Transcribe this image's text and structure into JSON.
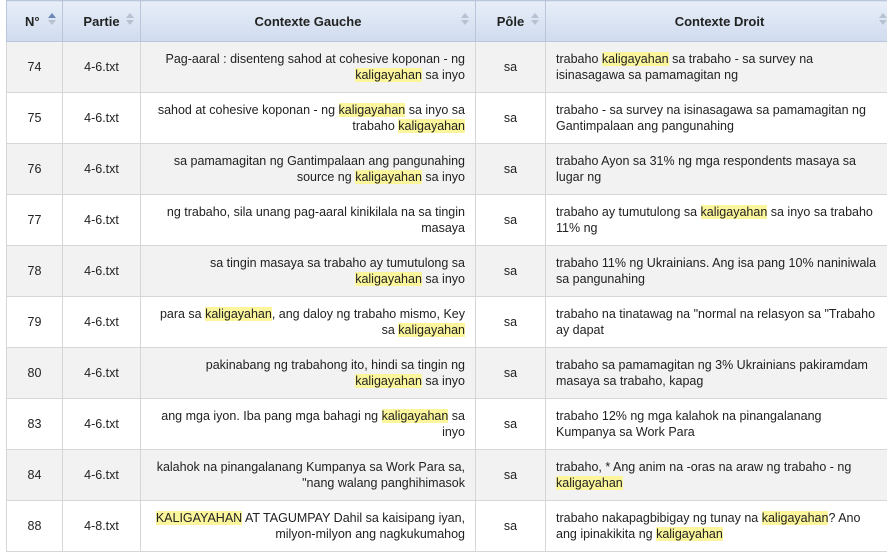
{
  "headers": {
    "no": "N°",
    "partie": "Partie",
    "gauche": "Contexte Gauche",
    "pole": "Pôle",
    "droit": "Contexte Droit"
  },
  "rows": [
    {
      "no": "74",
      "partie": "4-6.txt",
      "left": [
        {
          "t": "Pag-aaral : disenteng sahod at cohesive koponan - ng "
        },
        {
          "t": "kaligayahan",
          "h": true
        },
        {
          "t": " sa inyo"
        }
      ],
      "pole": "sa",
      "right": [
        {
          "t": "trabaho "
        },
        {
          "t": "kaligayahan",
          "h": true
        },
        {
          "t": " sa trabaho - sa survey na isinasagawa sa pamamagitan ng"
        }
      ]
    },
    {
      "no": "75",
      "partie": "4-6.txt",
      "left": [
        {
          "t": "sahod at cohesive koponan - ng "
        },
        {
          "t": "kaligayahan",
          "h": true
        },
        {
          "t": " sa inyo sa trabaho "
        },
        {
          "t": "kaligayahan",
          "h": true
        }
      ],
      "pole": "sa",
      "right": [
        {
          "t": "trabaho - sa survey na isinasagawa sa pamamagitan ng Gantimpalaan ang pangunahing"
        }
      ]
    },
    {
      "no": "76",
      "partie": "4-6.txt",
      "left": [
        {
          "t": "sa pamamagitan ng Gantimpalaan ang pangunahing source ng "
        },
        {
          "t": "kaligayahan",
          "h": true
        },
        {
          "t": " sa inyo"
        }
      ],
      "pole": "sa",
      "right": [
        {
          "t": "trabaho Ayon sa 31% ng mga respondents masaya sa lugar ng"
        }
      ]
    },
    {
      "no": "77",
      "partie": "4-6.txt",
      "left": [
        {
          "t": "ng trabaho, sila unang pag-aaral kinikilala na sa tingin masaya"
        }
      ],
      "pole": "sa",
      "right": [
        {
          "t": "trabaho ay tumutulong sa "
        },
        {
          "t": "kaligayahan",
          "h": true
        },
        {
          "t": " sa inyo sa trabaho 11% ng"
        }
      ]
    },
    {
      "no": "78",
      "partie": "4-6.txt",
      "left": [
        {
          "t": "sa tingin masaya sa trabaho ay tumutulong sa "
        },
        {
          "t": "kaligayahan",
          "h": true
        },
        {
          "t": " sa inyo"
        }
      ],
      "pole": "sa",
      "right": [
        {
          "t": "trabaho 11% ng Ukrainians. Ang isa pang 10% naniniwala sa pangunahing"
        }
      ]
    },
    {
      "no": "79",
      "partie": "4-6.txt",
      "left": [
        {
          "t": "para sa "
        },
        {
          "t": "kaligayahan",
          "h": true
        },
        {
          "t": ", ang daloy ng trabaho mismo, Key sa "
        },
        {
          "t": "kaligayahan",
          "h": true
        }
      ],
      "pole": "sa",
      "right": [
        {
          "t": "trabaho na tinatawag na \"normal na relasyon sa \"Trabaho ay dapat"
        }
      ]
    },
    {
      "no": "80",
      "partie": "4-6.txt",
      "left": [
        {
          "t": "pakinabang ng trabahong ito, hindi sa tingin ng "
        },
        {
          "t": "kaligayahan",
          "h": true
        },
        {
          "t": " sa inyo"
        }
      ],
      "pole": "sa",
      "right": [
        {
          "t": "trabaho sa pamamagitan ng 3% Ukrainians pakiramdam masaya sa trabaho, kapag"
        }
      ]
    },
    {
      "no": "83",
      "partie": "4-6.txt",
      "left": [
        {
          "t": "ang mga iyon. Iba pang mga bahagi ng "
        },
        {
          "t": "kaligayahan",
          "h": true
        },
        {
          "t": " sa inyo"
        }
      ],
      "pole": "sa",
      "right": [
        {
          "t": "trabaho 12% ng mga kalahok na pinangalanang Kumpanya sa Work Para"
        }
      ]
    },
    {
      "no": "84",
      "partie": "4-6.txt",
      "left": [
        {
          "t": "kalahok na pinangalanang Kumpanya sa Work Para sa, \"nang walang panghihimasok"
        }
      ],
      "pole": "sa",
      "right": [
        {
          "t": "trabaho, * Ang anim na -oras na araw ng trabaho - ng "
        },
        {
          "t": "kaligayahan",
          "h": true
        }
      ]
    },
    {
      "no": "88",
      "partie": "4-8.txt",
      "left": [
        {
          "t": "KALIGAYAHAN",
          "h": true
        },
        {
          "t": " AT TAGUMPAY Dahil sa kaisipang iyan, milyon-milyon ang nagkukumahog"
        }
      ],
      "pole": "sa",
      "right": [
        {
          "t": "trabaho nakapagbibigay ng tunay na "
        },
        {
          "t": "kaligayahan",
          "h": true
        },
        {
          "t": "? Ano ang ipinakikita ng "
        },
        {
          "t": "kaligayahan",
          "h": true
        }
      ]
    }
  ]
}
